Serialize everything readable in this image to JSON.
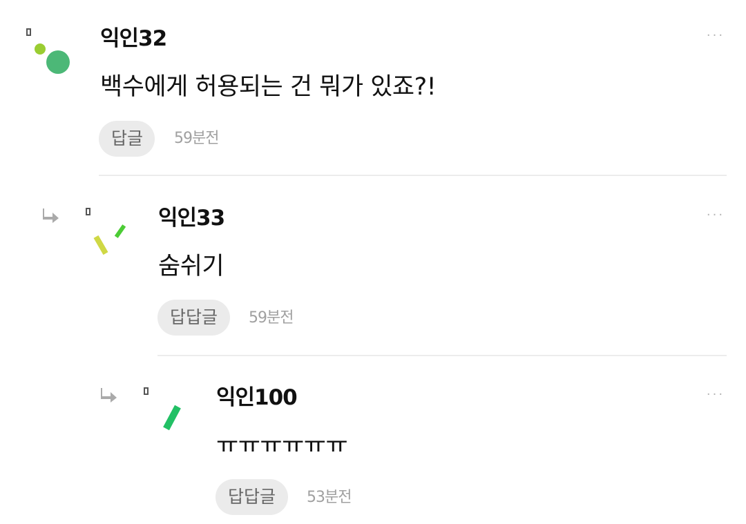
{
  "comments": [
    {
      "nickname": "익인32",
      "text": "백수에게 허용되는 건 뭐가 있죠?!",
      "reply_label": "답글",
      "time": "59분전",
      "more_label": "···"
    },
    {
      "nickname": "익인33",
      "text": "숨쉬기",
      "reply_label": "답답글",
      "time": "59분전",
      "more_label": "···"
    },
    {
      "nickname": "익인100",
      "text": "ㅠㅠㅠㅠㅠㅠ",
      "reply_label": "답답글",
      "time": "53분전",
      "more_label": "···"
    }
  ],
  "colors": {
    "avatar_green": "#4cb877",
    "avatar_lime": "#9acd32",
    "avatar_olive": "#cfd845",
    "avatar_bright": "#4ccc35",
    "avatar_emerald": "#22c065",
    "reply_arrow": "#aaaaaa"
  },
  "icons": {
    "reply_arrow": "reply-arrow-icon",
    "more": "more-options-icon"
  }
}
